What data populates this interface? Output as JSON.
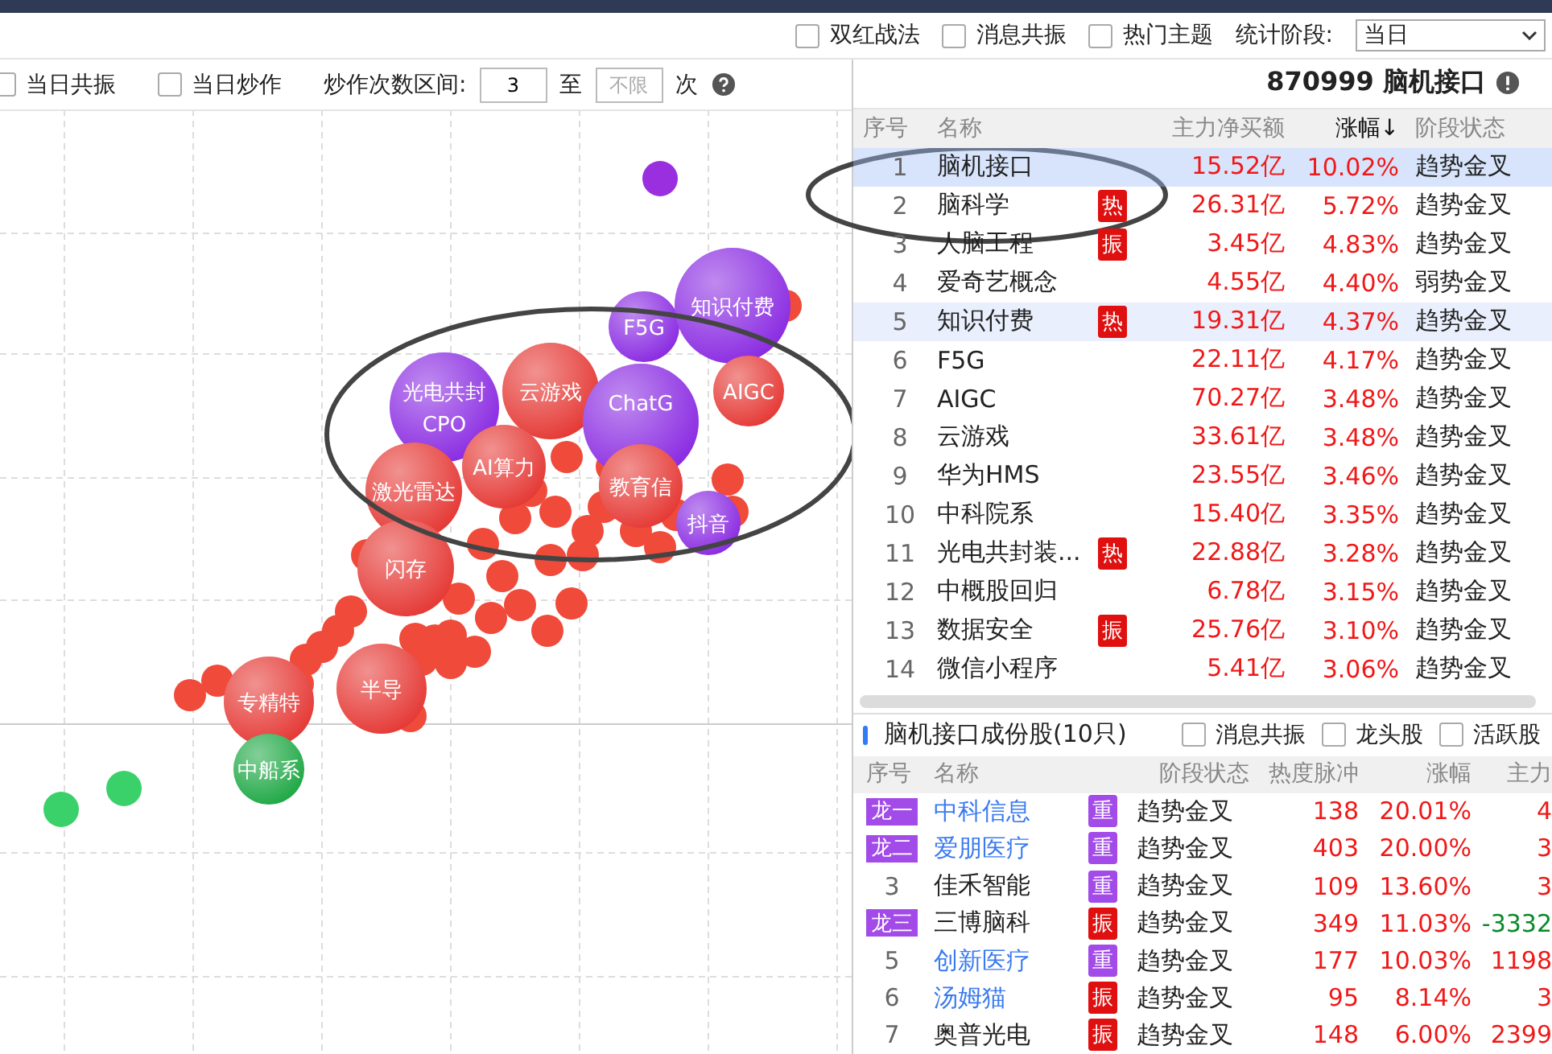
{
  "top_filters": [
    {
      "label": "双红战法",
      "checked": false
    },
    {
      "label": "消息共振",
      "checked": false
    },
    {
      "label": "热门主题",
      "checked": false
    }
  ],
  "period": {
    "label": "统计阶段:",
    "value": "当日"
  },
  "left_filters": {
    "checkboxes": [
      {
        "label": "当日共振",
        "checked": false
      },
      {
        "label": "当日炒作",
        "checked": false
      }
    ],
    "range_label": "炒作次数区间:",
    "from_value": "3",
    "to_label": "至",
    "to_placeholder": "不限",
    "unit": "次"
  },
  "bubbles": [
    {
      "labels": [
        "F5G"
      ],
      "color": "#8a2be2"
    },
    {
      "labels": [
        "知识付费"
      ],
      "color": "#8a2be2"
    },
    {
      "labels": [
        "光电共封",
        "CPO"
      ],
      "color": "#8a2be2"
    },
    {
      "labels": [
        "云游戏"
      ],
      "color": "#e53935"
    },
    {
      "labels": [
        "AIGC"
      ],
      "color": "#e53935"
    },
    {
      "labels": [
        "ChatG"
      ],
      "color": "#8a2be2"
    },
    {
      "labels": [
        "AI算力"
      ],
      "color": "#e53935"
    },
    {
      "labels": [
        "教育信"
      ],
      "color": "#e53935"
    },
    {
      "labels": [
        "激光雷达"
      ],
      "color": "#e53935"
    },
    {
      "labels": [
        "抖音"
      ],
      "color": "#8a2be2"
    },
    {
      "labels": [
        "闪存"
      ],
      "color": "#e53935"
    },
    {
      "labels": [
        "专精特"
      ],
      "color": "#e53935"
    },
    {
      "labels": [
        "半导"
      ],
      "color": "#e53935"
    },
    {
      "labels": [
        "中船系"
      ],
      "color": "#1fa845"
    }
  ],
  "sector": {
    "title": "870999 脑机接口"
  },
  "sector_table": {
    "columns": [
      "序号",
      "名称",
      "主力净买额",
      "涨幅↓",
      "阶段状态"
    ],
    "rows": [
      {
        "no": "1",
        "name": "脑机接口",
        "amount": "15.52亿",
        "change": "10.02%",
        "state": "趋势金叉",
        "selected": true,
        "hovered": false
      },
      {
        "no": "2",
        "name": "脑科学",
        "tag": {
          "text": "热",
          "color": "#e01010"
        },
        "amount": "26.31亿",
        "change": "5.72%",
        "state": "趋势金叉",
        "selected": false,
        "hovered": false
      },
      {
        "no": "3",
        "name": "人脑工程",
        "tag": {
          "text": "振",
          "color": "#e01010"
        },
        "amount": "3.45亿",
        "change": "4.83%",
        "state": "趋势金叉",
        "selected": false,
        "hovered": false
      },
      {
        "no": "4",
        "name": "爱奇艺概念",
        "amount": "4.55亿",
        "change": "4.40%",
        "state": "弱势金叉",
        "selected": false,
        "hovered": false
      },
      {
        "no": "5",
        "name": "知识付费",
        "tag": {
          "text": "热",
          "color": "#e01010"
        },
        "amount": "19.31亿",
        "change": "4.37%",
        "state": "趋势金叉",
        "selected": false,
        "hovered": true
      },
      {
        "no": "6",
        "name": "F5G",
        "amount": "22.11亿",
        "change": "4.17%",
        "state": "趋势金叉",
        "selected": false,
        "hovered": false
      },
      {
        "no": "7",
        "name": "AIGC",
        "amount": "70.27亿",
        "change": "3.48%",
        "state": "趋势金叉",
        "selected": false,
        "hovered": false
      },
      {
        "no": "8",
        "name": "云游戏",
        "amount": "33.61亿",
        "change": "3.48%",
        "state": "趋势金叉",
        "selected": false,
        "hovered": false
      },
      {
        "no": "9",
        "name": "华为HMS",
        "amount": "23.55亿",
        "change": "3.46%",
        "state": "趋势金叉",
        "selected": false,
        "hovered": false
      },
      {
        "no": "10",
        "name": "中科院系",
        "amount": "15.40亿",
        "change": "3.35%",
        "state": "趋势金叉",
        "selected": false,
        "hovered": false
      },
      {
        "no": "11",
        "name": "光电共封装...",
        "tag": {
          "text": "热",
          "color": "#e01010"
        },
        "amount": "22.88亿",
        "change": "3.28%",
        "state": "趋势金叉",
        "selected": false,
        "hovered": false
      },
      {
        "no": "12",
        "name": "中概股回归",
        "amount": "6.78亿",
        "change": "3.15%",
        "state": "趋势金叉",
        "selected": false,
        "hovered": false
      },
      {
        "no": "13",
        "name": "数据安全",
        "tag": {
          "text": "振",
          "color": "#e01010"
        },
        "amount": "25.76亿",
        "change": "3.10%",
        "state": "趋势金叉",
        "selected": false,
        "hovered": false
      },
      {
        "no": "14",
        "name": "微信小程序",
        "amount": "5.41亿",
        "change": "3.06%",
        "state": "趋势金叉",
        "selected": false,
        "hovered": false
      }
    ]
  },
  "stocks": {
    "title": "脑机接口成份股(10只)",
    "filters": [
      {
        "label": "消息共振",
        "checked": false
      },
      {
        "label": "龙头股",
        "checked": false
      },
      {
        "label": "活跃股",
        "checked": false
      }
    ],
    "columns": [
      "序号",
      "名称",
      "阶段状态",
      "热度脉冲",
      "涨幅",
      "主力"
    ],
    "rows": [
      {
        "rank": "龙一",
        "name": "中科信息",
        "link": true,
        "tag": {
          "text": "重",
          "color": "#a24be8"
        },
        "state": "趋势金叉",
        "heat": "138",
        "change": "20.01%",
        "main": "4",
        "main_negative": false
      },
      {
        "rank": "龙二",
        "name": "爱朋医疗",
        "link": true,
        "tag": {
          "text": "重",
          "color": "#a24be8"
        },
        "state": "趋势金叉",
        "heat": "403",
        "change": "20.00%",
        "main": "3",
        "main_negative": false
      },
      {
        "no": "3",
        "name": "佳禾智能",
        "link": false,
        "tag": {
          "text": "重",
          "color": "#a24be8"
        },
        "state": "趋势金叉",
        "heat": "109",
        "change": "13.60%",
        "main": "3",
        "main_negative": false
      },
      {
        "rank": "龙三",
        "name": "三博脑科",
        "link": false,
        "tag": {
          "text": "振",
          "color": "#e01010"
        },
        "state": "趋势金叉",
        "heat": "349",
        "change": "11.03%",
        "main": "-3332",
        "main_negative": true
      },
      {
        "no": "5",
        "name": "创新医疗",
        "link": true,
        "tag": {
          "text": "重",
          "color": "#a24be8"
        },
        "state": "趋势金叉",
        "heat": "177",
        "change": "10.03%",
        "main": "1198",
        "main_negative": false
      },
      {
        "no": "6",
        "name": "汤姆猫",
        "link": true,
        "tag": {
          "text": "振",
          "color": "#e01010"
        },
        "state": "趋势金叉",
        "heat": "95",
        "change": "8.14%",
        "main": "3",
        "main_negative": false
      },
      {
        "no": "7",
        "name": "奥普光电",
        "link": false,
        "tag": {
          "text": "振",
          "color": "#e01010"
        },
        "state": "趋势金叉",
        "heat": "148",
        "change": "6.00%",
        "main": "2399",
        "main_negative": false
      }
    ]
  }
}
